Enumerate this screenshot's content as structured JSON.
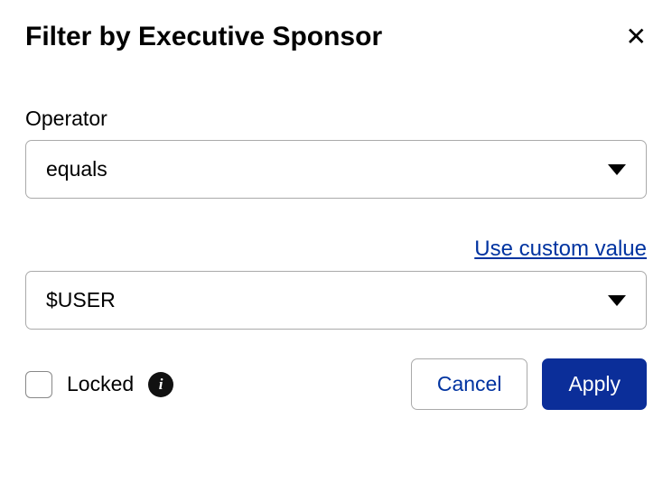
{
  "header": {
    "title": "Filter by Executive Sponsor"
  },
  "operator": {
    "label": "Operator",
    "value": "equals"
  },
  "custom_value_link": "Use custom value",
  "value_select": {
    "value": "$USER"
  },
  "locked": {
    "label": "Locked",
    "checked": false
  },
  "buttons": {
    "cancel": "Cancel",
    "apply": "Apply"
  }
}
